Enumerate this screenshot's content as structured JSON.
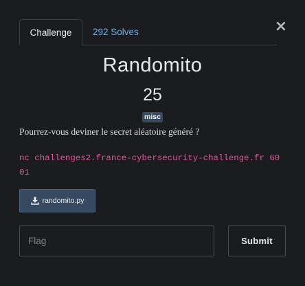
{
  "modal": {
    "close_glyph": "×"
  },
  "tabs": [
    {
      "label": "Challenge",
      "active": true
    },
    {
      "label": "292 Solves",
      "active": false
    }
  ],
  "challenge": {
    "name": "Randomito",
    "points": "25",
    "category": "misc",
    "description": "Pourrez-vous deviner le secret aléatoire généré ?",
    "connection": "nc challenges2.france-cybersecurity-challenge.fr 6001"
  },
  "files": [
    {
      "name": "randomito.py",
      "icon": "download-icon"
    }
  ],
  "submission": {
    "placeholder": "Flag",
    "value": "",
    "submit_label": "Submit"
  },
  "colors": {
    "background": "#1b1c1e",
    "link": "#74aee0",
    "code": "#e2549a",
    "badge": "#3a4a5d",
    "download_button": "#364a61"
  }
}
